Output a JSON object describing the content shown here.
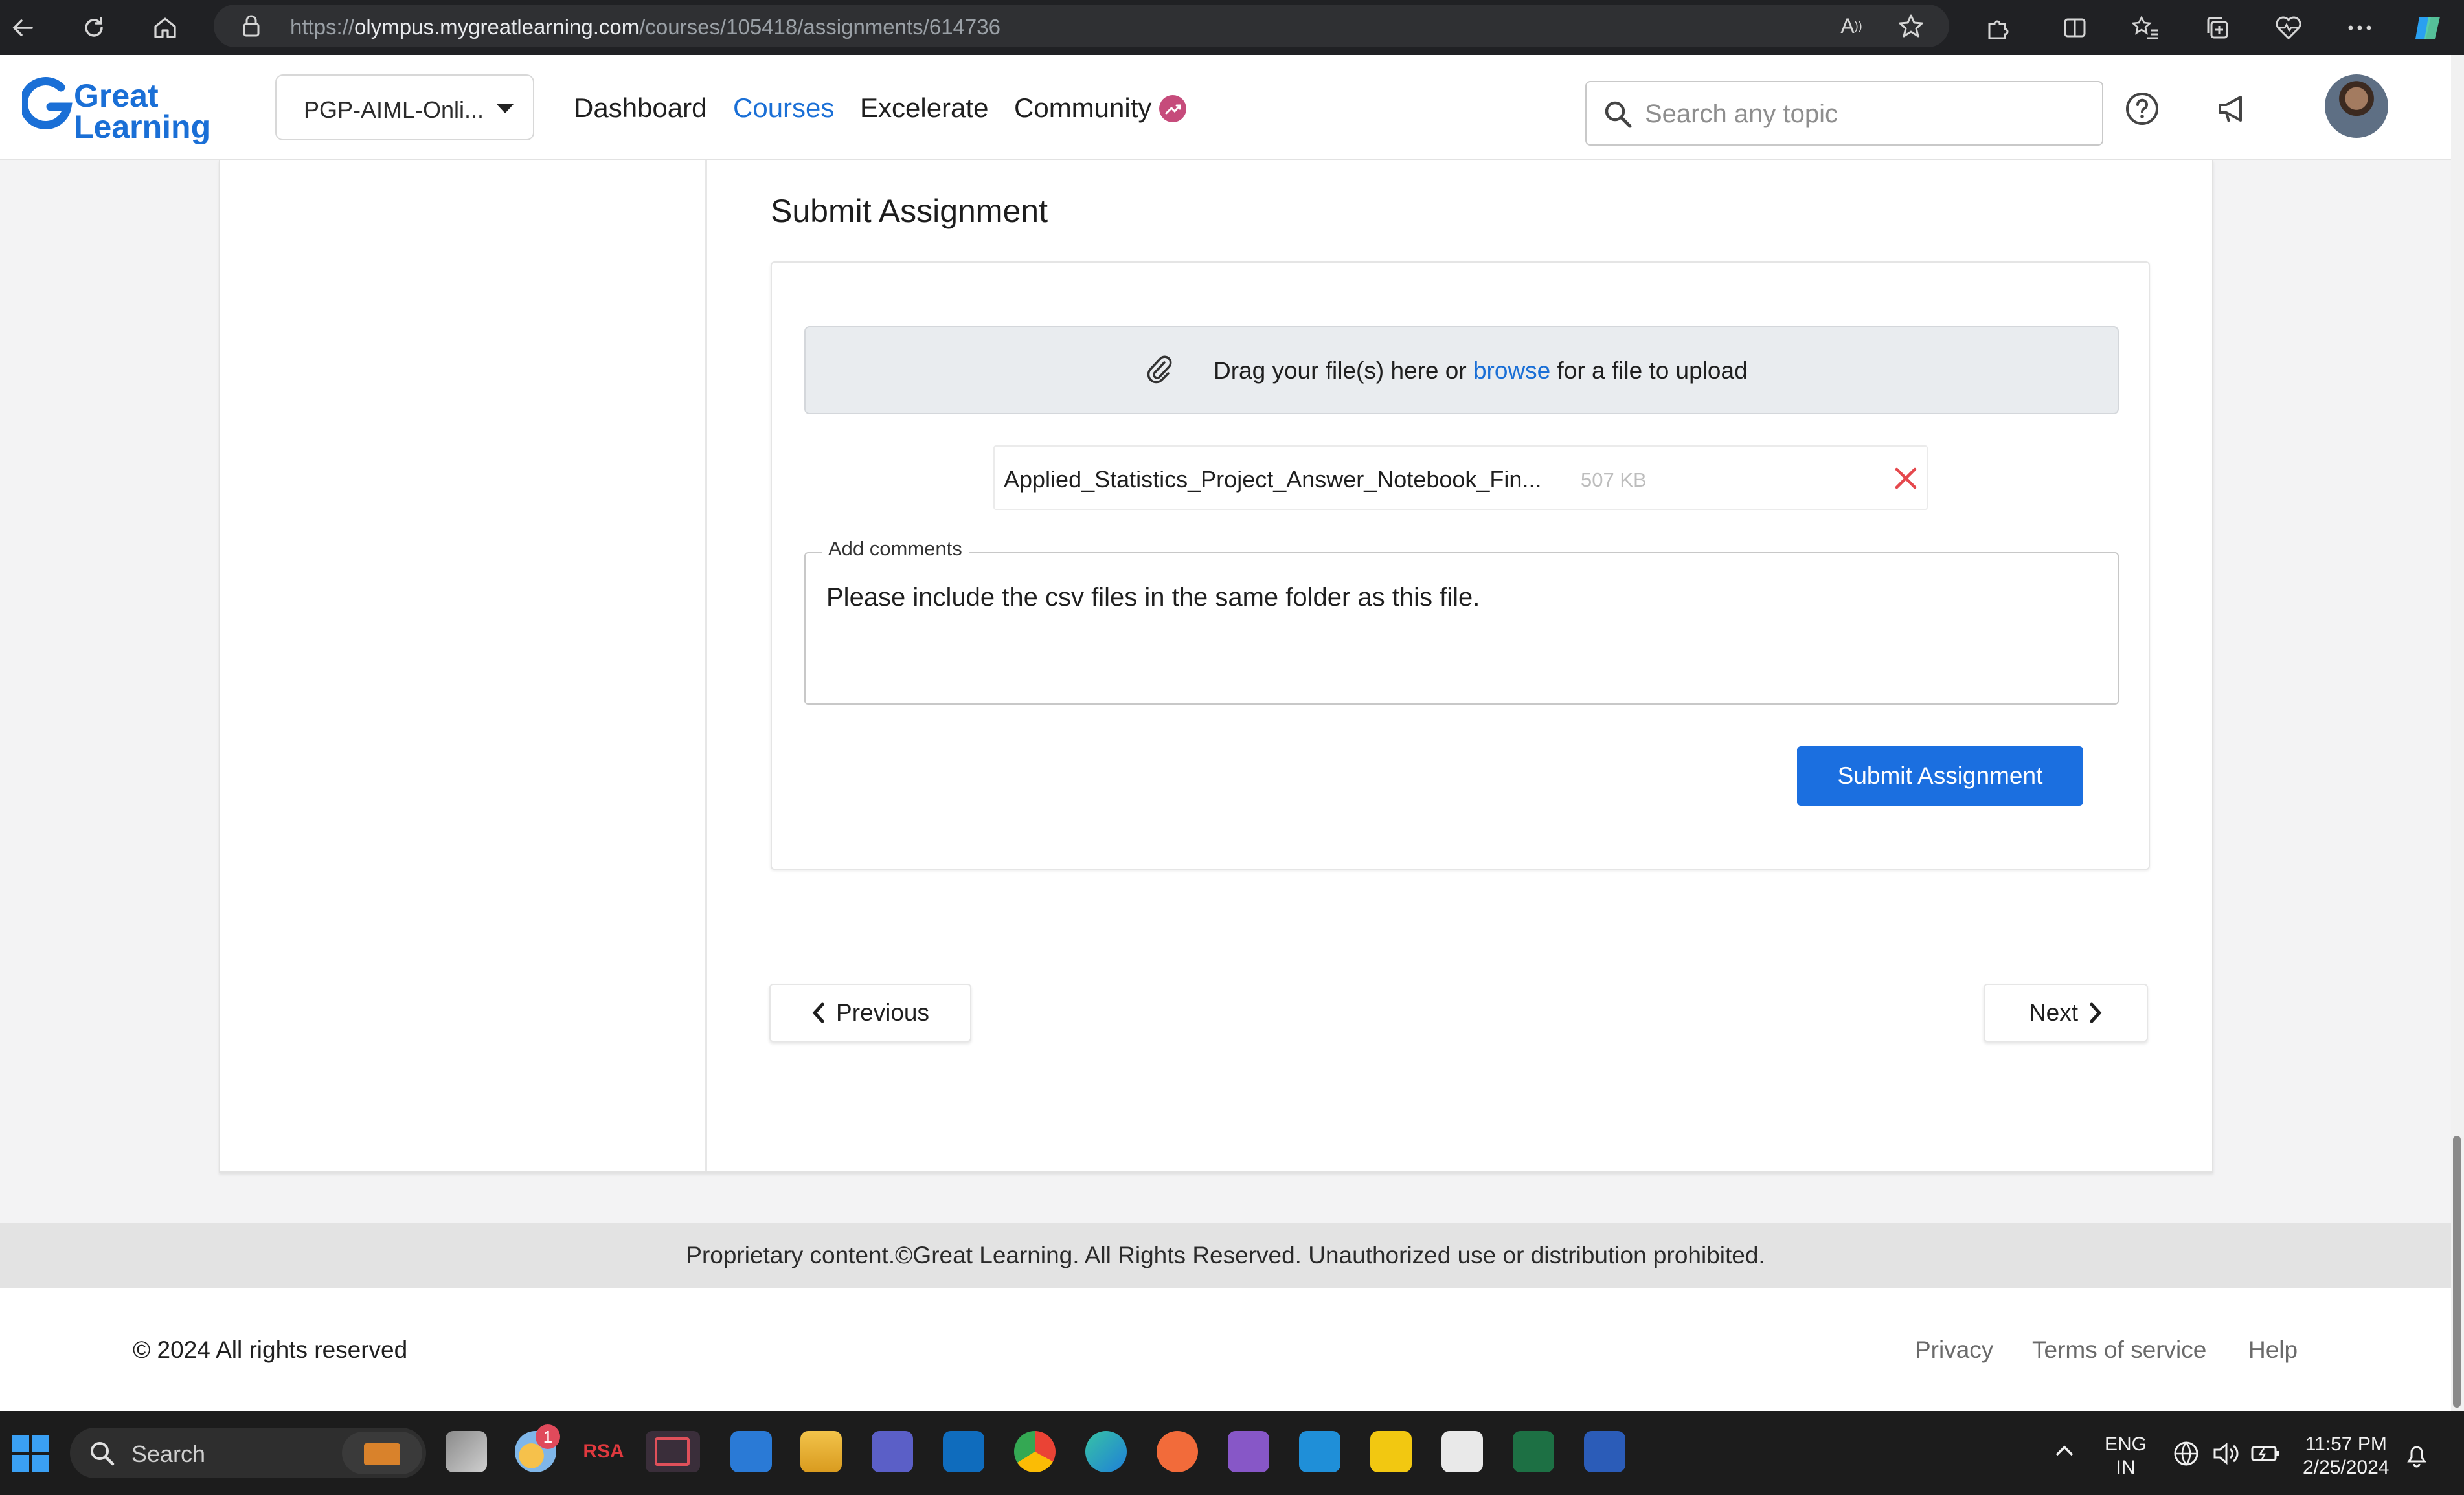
{
  "browser": {
    "url_prefix": "https://",
    "url_domain": "olympus.mygreatlearning.com",
    "url_path": "/courses/105418/assignments/614736"
  },
  "header": {
    "logo_line1": "Great",
    "logo_line2": "Learning",
    "program_selector": "PGP-AIML-Onli...",
    "nav": {
      "dashboard": "Dashboard",
      "courses": "Courses",
      "excelerate": "Excelerate",
      "community": "Community"
    },
    "search_placeholder": "Search any topic",
    "colors": {
      "brand_blue": "#1a6fd6",
      "community_badge": "#c64b7b"
    }
  },
  "submission": {
    "title": "Submit Assignment",
    "dropzone": {
      "before": "Drag your file(s) here or ",
      "link": "browse",
      "after": " for a file to upload"
    },
    "file": {
      "name": "Applied_Statistics_Project_Answer_Notebook_Fin...",
      "size": "507 KB"
    },
    "comments": {
      "label": "Add comments",
      "value": "Please include the csv files in the same folder as this file."
    },
    "submit_label": "Submit Assignment",
    "colors": {
      "submit_bg": "#1b6fe0",
      "remove_icon": "#e5484d"
    }
  },
  "pager": {
    "previous": "Previous",
    "next": "Next"
  },
  "footer": {
    "proprietary": "Proprietary content.©Great Learning. All Rights Reserved. Unauthorized use or distribution prohibited.",
    "copyright": "© 2024 All rights reserved",
    "links": [
      "Privacy",
      "Terms of service",
      "Help"
    ]
  },
  "taskbar": {
    "search_label": "Search",
    "weather_badge": "1",
    "rsa_label": "RSA",
    "language_line1": "ENG",
    "language_line2": "IN",
    "time": "11:57 PM",
    "date": "2/25/2024"
  }
}
